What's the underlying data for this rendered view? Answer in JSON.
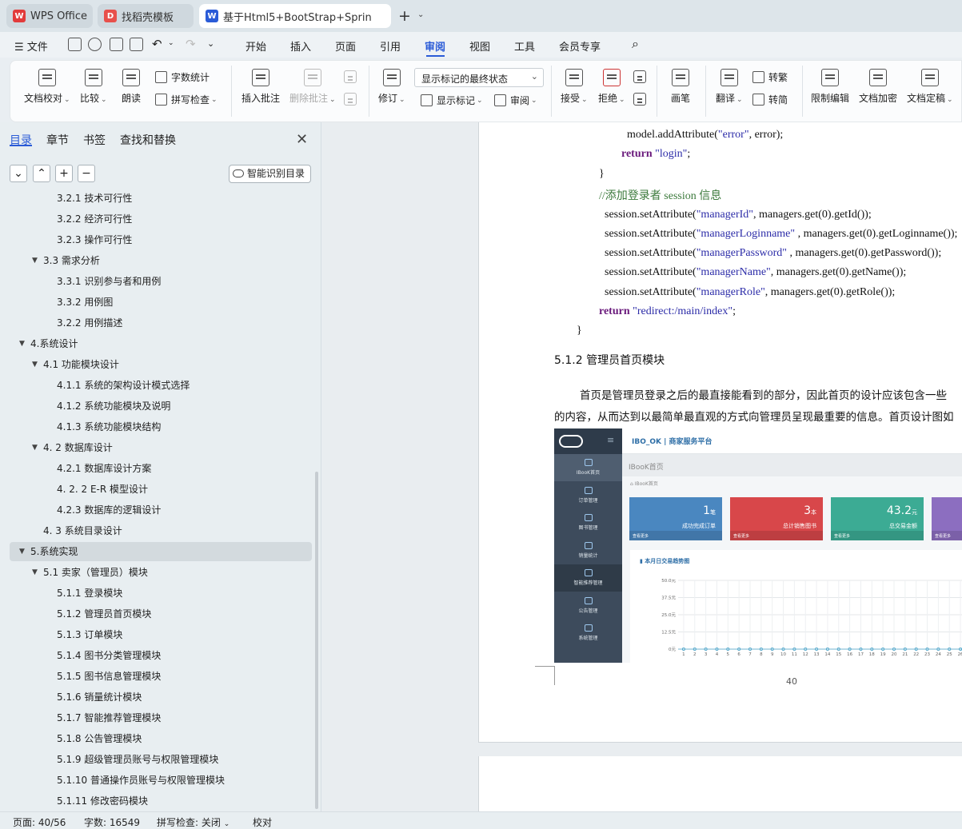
{
  "tabs": [
    {
      "label": "WPS Office",
      "icon": "wps-logo-icon"
    },
    {
      "label": "找稻壳模板",
      "icon": "docer-icon"
    },
    {
      "label": "基于Html5+BootStrap+Sprin",
      "icon": "word-doc-icon"
    }
  ],
  "menu": {
    "file": "文件",
    "items": [
      "开始",
      "插入",
      "页面",
      "引用",
      "审阅",
      "视图",
      "工具",
      "会员专享"
    ],
    "active": "审阅"
  },
  "ribbon": {
    "doc_proof": "文档校对",
    "compare": "比较",
    "read_aloud": "朗读",
    "word_count": "字数统计",
    "spell_check": "拼写检查",
    "insert_comment": "插入批注",
    "delete_comment": "删除批注",
    "revise": "修订",
    "markup_state": "显示标记的最终状态",
    "show_markup": "显示标记",
    "review": "审阅",
    "accept": "接受",
    "reject": "拒绝",
    "pen": "画笔",
    "translate": "翻译",
    "to_traditional": "转繁",
    "to_simplified": "转简",
    "restrict_edit": "限制编辑",
    "doc_encrypt": "文档加密",
    "doc_finalize": "文档定稿"
  },
  "sidebar": {
    "tabs": [
      "目录",
      "章节",
      "书签",
      "查找和替换"
    ],
    "smart_toc": "智能识别目录",
    "toc": [
      {
        "text": "3.2.1 技术可行性",
        "level": 3
      },
      {
        "text": "3.2.2 经济可行性",
        "level": 3
      },
      {
        "text": "3.2.3 操作可行性",
        "level": 3
      },
      {
        "text": "3.3  需求分析",
        "level": 2,
        "expanded": true
      },
      {
        "text": "3.3.1  识别参与者和用例",
        "level": 3
      },
      {
        "text": "3.3.2  用例图",
        "level": 3
      },
      {
        "text": "3.2.2 用例描述",
        "level": 3
      },
      {
        "text": "4.系统设计",
        "level": 1,
        "expanded": true
      },
      {
        "text": "4.1 功能模块设计",
        "level": 2,
        "expanded": true
      },
      {
        "text": "4.1.1 系统的架构设计模式选择",
        "level": 3
      },
      {
        "text": "4.1.2 系统功能模块及说明",
        "level": 3
      },
      {
        "text": "4.1.3 系统功能模块结构",
        "level": 3
      },
      {
        "text": "4. 2 数据库设计",
        "level": 2,
        "expanded": true
      },
      {
        "text": "4.2.1 数据库设计方案",
        "level": 3
      },
      {
        "text": "4. 2. 2 E-R 模型设计",
        "level": 3
      },
      {
        "text": "4.2.3 数据库的逻辑设计",
        "level": 3
      },
      {
        "text": "4. 3  系统目录设计",
        "level": 2
      },
      {
        "text": "5.系统实现",
        "level": 1,
        "expanded": true,
        "selected": true
      },
      {
        "text": "5.1  卖家（管理员）模块",
        "level": 2,
        "expanded": true
      },
      {
        "text": "5.1.1  登录模块",
        "level": 3
      },
      {
        "text": "5.1.2  管理员首页模块",
        "level": 3
      },
      {
        "text": "5.1.3  订单模块",
        "level": 3
      },
      {
        "text": "5.1.4  图书分类管理模块",
        "level": 3
      },
      {
        "text": "5.1.5  图书信息管理模块",
        "level": 3
      },
      {
        "text": "5.1.6  销量统计模块",
        "level": 3
      },
      {
        "text": "5.1.7  智能推荐管理模块",
        "level": 3
      },
      {
        "text": "5.1.8  公告管理模块",
        "level": 3
      },
      {
        "text": "5.1.9  超级管理员账号与权限管理模块",
        "level": 3
      },
      {
        "text": "5.1.10  普通操作员账号与权限管理模块",
        "level": 3
      },
      {
        "text": "5.1.11  修改密码模块",
        "level": 3
      }
    ]
  },
  "document": {
    "code": {
      "l1_a": "model.addAttribute(",
      "l1_s": "\"error\"",
      "l1_b": ", error);",
      "l2_k": "return",
      "l2_s": " \"login\"",
      "l2_b": ";",
      "l3": "}",
      "l4": "//添加登录者 session 信息",
      "l5_a": "session.setAttribute(",
      "l5_s": "\"managerId\"",
      "l5_b": ", managers.get(0).getId());",
      "l6_a": "session.setAttribute(",
      "l6_s": "\"managerLoginname\"",
      "l6_b": " , managers.get(0).getLoginname());",
      "l7_a": "session.setAttribute(",
      "l7_s": "\"managerPassword\"",
      "l7_b": " , managers.get(0).getPassword());",
      "l8_a": "session.setAttribute(",
      "l8_s": "\"managerName\"",
      "l8_b": ", managers.get(0).getName());",
      "l9_a": "session.setAttribute(",
      "l9_s": "\"managerRole\"",
      "l9_b": ", managers.get(0).getRole());",
      "l10_k": "return",
      "l10_s": " \"redirect:/main/index\"",
      "l10_b": ";",
      "l11": "}"
    },
    "heading": "5.1.2  管理员首页模块",
    "para1": "首页是管理员登录之后的最直接能看到的部分，因此首页的设计应该包含一些",
    "para2": "的内容，从而达到以最简单最直观的方式向管理员呈现最重要的信息。首页设计图如",
    "page_number": "40",
    "screenshot": {
      "brand": "IBO_OK | 商家服务平台",
      "breadcrumb": "IBooK首页",
      "sub_crumb": "IBooK首页",
      "nav": [
        "IBooK首页",
        "订单管理",
        "图书管理",
        "销量统计",
        "智能推荐管理",
        "公告管理",
        "系统管理"
      ],
      "cards": [
        {
          "num": "1",
          "unit": "笔",
          "label": "成功完成订单",
          "foot": "查看更多",
          "color": "#4a87c0"
        },
        {
          "num": "3",
          "unit": "本",
          "label": "总计销售图书",
          "foot": "查看更多",
          "color": "#d8474a"
        },
        {
          "num": "43.2",
          "unit": "元",
          "label": "总交易金额",
          "foot": "查看更多",
          "color": "#3cab94"
        },
        {
          "num": "",
          "unit": "",
          "label": "",
          "foot": "查看更多",
          "color": "#8c6ec0"
        }
      ],
      "chart_title": "本月日交易趋势图",
      "y_ticks": [
        "50.0元",
        "37.5元",
        "25.0元",
        "12.5元",
        "0元"
      ],
      "x_ticks": [
        "1",
        "2",
        "3",
        "4",
        "5",
        "6",
        "7",
        "8",
        "9",
        "10",
        "11",
        "12",
        "13",
        "14",
        "15",
        "16",
        "17",
        "18",
        "19",
        "20",
        "21",
        "22",
        "23",
        "24",
        "25",
        "26"
      ]
    }
  },
  "status": {
    "page": "页面: 40/56",
    "words": "字数: 16549",
    "spell": "拼写检查: 关闭",
    "proof": "校对"
  }
}
